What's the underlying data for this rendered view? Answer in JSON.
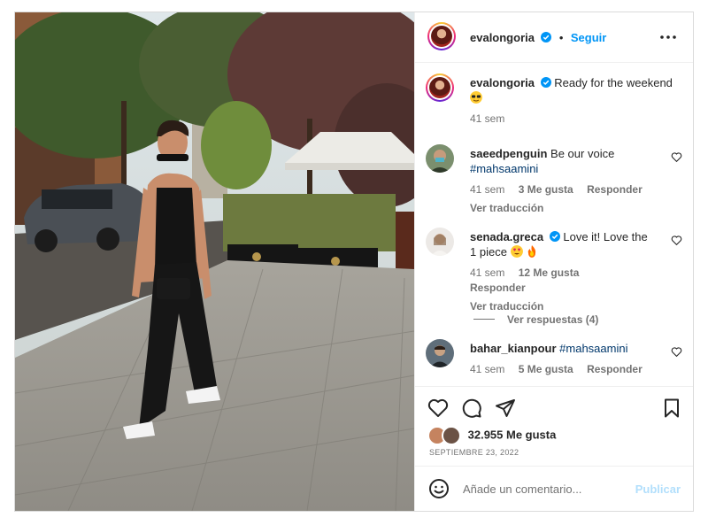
{
  "post": {
    "author": {
      "username": "evalongoria",
      "verified": true,
      "follow_label": "Seguir",
      "separator": "•"
    },
    "caption": {
      "username": "evalongoria",
      "text": "Ready for the weekend",
      "emoji": "sunglasses",
      "time": "41 sem"
    },
    "comments": [
      {
        "username": "saeedpenguin",
        "verified": false,
        "text": "Be our voice",
        "hashtag": "#mahsaamini",
        "time": "41 sem",
        "likes": "3 Me gusta",
        "reply": "Responder",
        "translate": "Ver traducción"
      },
      {
        "username": "senada.greca",
        "verified": true,
        "text": "Love it! Love the 1 piece",
        "emojis": [
          "heart-eyes",
          "fire"
        ],
        "time": "41 sem",
        "likes": "12 Me gusta",
        "reply": "Responder",
        "translate": "Ver traducción",
        "view_replies": "Ver respuestas (4)"
      },
      {
        "username": "bahar_kianpour",
        "verified": false,
        "hashtag": "#mahsaamini",
        "time": "41 sem",
        "likes": "5 Me gusta",
        "reply": "Responder"
      }
    ],
    "likes_count": "32.955 Me gusta",
    "date": "SEPTIEMBRE 23, 2022",
    "add_comment": {
      "placeholder": "Añade un comentario...",
      "publish_label": "Publicar"
    }
  },
  "colors": {
    "accent": "#0095f6",
    "hashtag": "#00376b",
    "muted": "#737373",
    "publish_disabled": "#b2dffc"
  },
  "icons": [
    "verified-badge-icon",
    "more-options-icon",
    "heart-icon",
    "comment-icon",
    "share-icon",
    "save-icon",
    "emoji-icon"
  ]
}
